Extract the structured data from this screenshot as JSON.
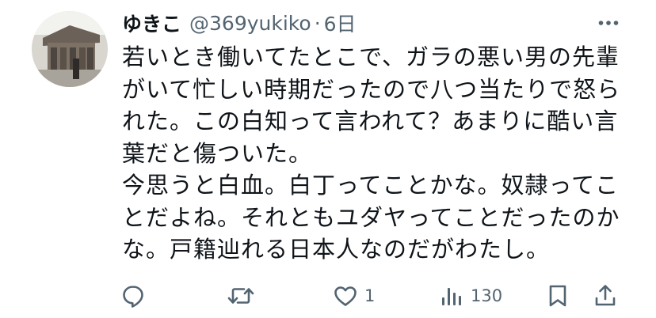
{
  "user": {
    "display_name": "ゆきこ",
    "handle": "@369yukiko",
    "separator": "·",
    "time": "6日"
  },
  "tweet": {
    "lines": [
      "若いとき働いてたとこで、ガラの悪い男の先輩",
      "がいて忙しい時期だったので八つ当たりで怒ら",
      "れた。この白知って言われて？あまりに酷い言",
      "葉だと傷ついた。",
      "今思うと白血。白丁ってことかな。奴隷ってこ",
      "とだよね。それともユダヤってことだったのか",
      "な。戸籍辿れる日本人なのだがわたし。"
    ]
  },
  "actions": {
    "reply_count": "",
    "retweet_count": "",
    "like_count": "1",
    "view_count": "130"
  },
  "icons": {
    "more": "more-horizontal-icon",
    "reply": "reply-icon",
    "retweet": "retweet-icon",
    "like": "heart-icon",
    "views": "views-icon",
    "bookmark": "bookmark-icon",
    "share": "share-icon"
  },
  "colors": {
    "text_primary": "#0f1419",
    "text_secondary": "#536471",
    "background": "#ffffff"
  }
}
